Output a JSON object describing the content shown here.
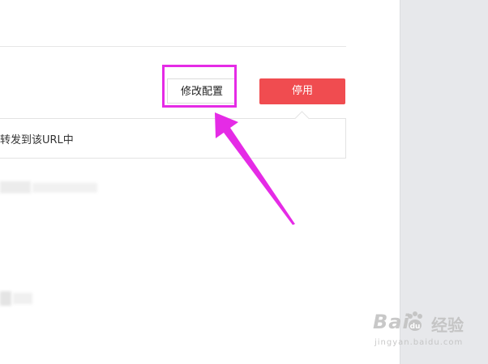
{
  "buttons": {
    "modify": "修改配置",
    "disable": "停用"
  },
  "callout": {
    "text": "转发到该URL中"
  },
  "watermark": {
    "logo": "Bai",
    "logo_tail": "du",
    "jingyan": "经验",
    "url": "jingyan.baidu.com"
  },
  "colors": {
    "disable_button": "#f04c50",
    "highlight": "#e52be6",
    "sidebar": "#e7e8eb"
  },
  "icons": {
    "arrow": "annotation-arrow-icon",
    "paw": "baidu-paw-icon"
  }
}
